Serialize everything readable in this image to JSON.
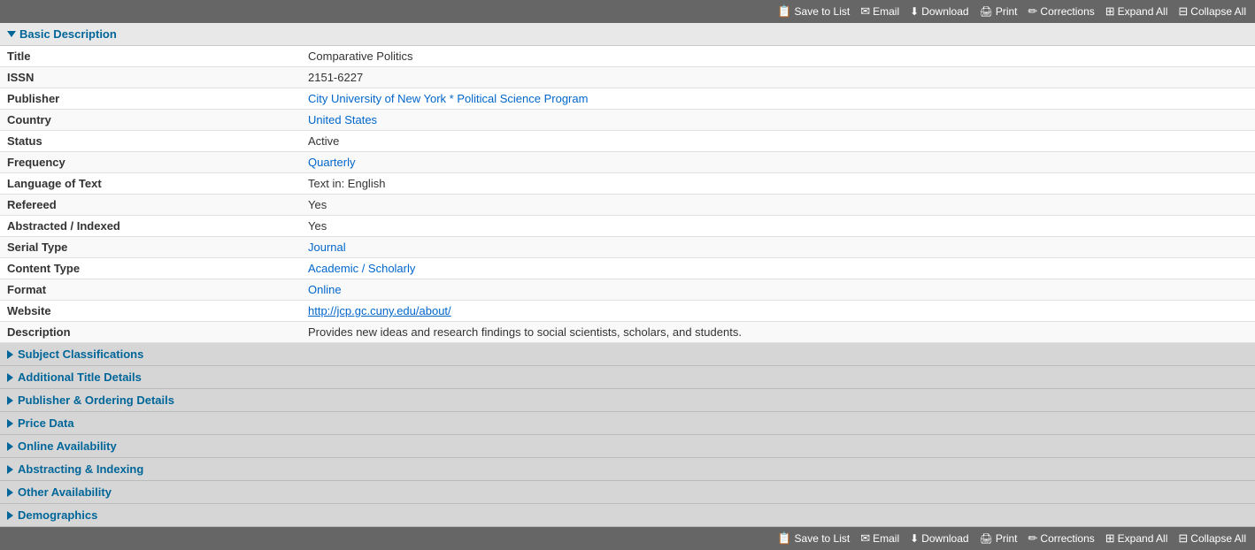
{
  "toolbar": {
    "save_label": "Save to List",
    "email_label": "Email",
    "download_label": "Download",
    "print_label": "Print",
    "corrections_label": "Corrections",
    "expand_label": "Expand All",
    "collapse_label": "Collapse All"
  },
  "basic_description": {
    "header": "Basic Description",
    "fields": [
      {
        "label": "Title",
        "value": "Comparative Politics",
        "type": "text"
      },
      {
        "label": "ISSN",
        "value": "2151-6227",
        "type": "text"
      },
      {
        "label": "Publisher",
        "value": "City University of New York * Political Science Program",
        "type": "link"
      },
      {
        "label": "Country",
        "value": "United States",
        "type": "link"
      },
      {
        "label": "Status",
        "value": "Active",
        "type": "text"
      },
      {
        "label": "Frequency",
        "value": "Quarterly",
        "type": "link"
      },
      {
        "label": "Language of Text",
        "value": "Text in: English",
        "type": "text"
      },
      {
        "label": "Refereed",
        "value": "Yes",
        "type": "text"
      },
      {
        "label": "Abstracted / Indexed",
        "value": "Yes",
        "type": "text"
      },
      {
        "label": "Serial Type",
        "value": "Journal",
        "type": "link"
      },
      {
        "label": "Content Type",
        "value": "Academic / Scholarly",
        "type": "link"
      },
      {
        "label": "Format",
        "value": "Online",
        "type": "link"
      },
      {
        "label": "Website",
        "value": "http://jcp.gc.cuny.edu/about/",
        "type": "url"
      },
      {
        "label": "Description",
        "value": "Provides new ideas and research findings to social scientists, scholars, and students.",
        "type": "text"
      }
    ]
  },
  "collapsible_sections": [
    {
      "label": "Subject Classifications"
    },
    {
      "label": "Additional Title Details"
    },
    {
      "label": "Publisher & Ordering Details"
    },
    {
      "label": "Price Data"
    },
    {
      "label": "Online Availability"
    },
    {
      "label": "Abstracting & Indexing"
    },
    {
      "label": "Other Availability"
    },
    {
      "label": "Demographics"
    }
  ]
}
